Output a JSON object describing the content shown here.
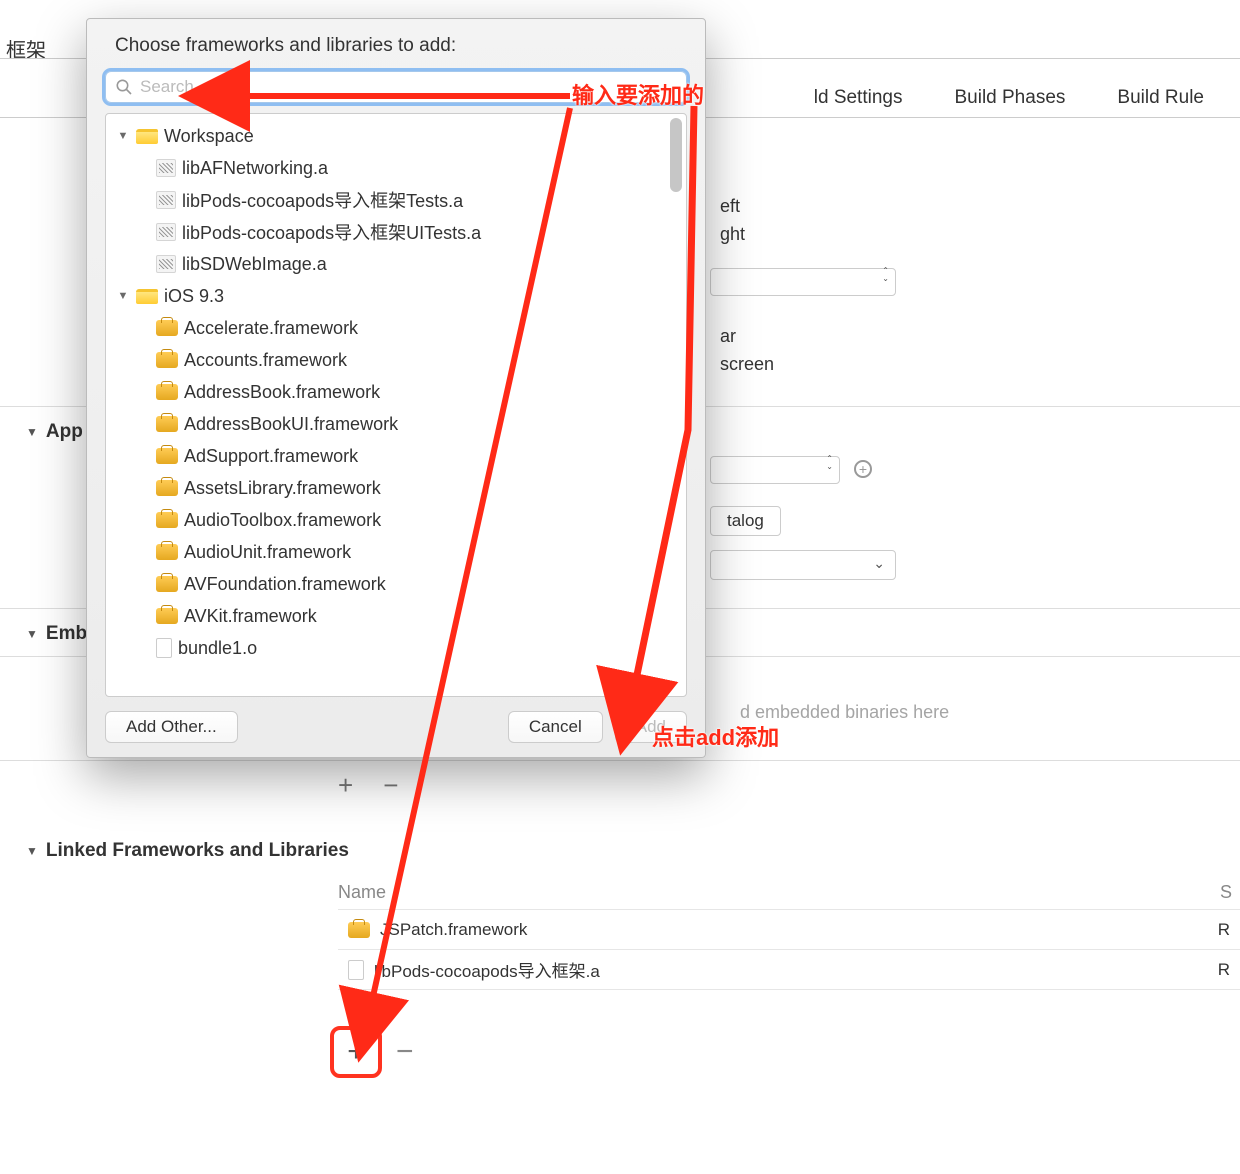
{
  "top_partial": "框架",
  "tabs": {
    "settings": "ld Settings",
    "phases": "Build Phases",
    "rules": "Build Rule"
  },
  "bg": {
    "eft": "eft",
    "ght": "ght",
    "ar": "ar",
    "screen": "screen",
    "talog": "talog",
    "embed_placeholder": "d embedded binaries here"
  },
  "sections": {
    "app": "App I",
    "embed": "Embe",
    "linked": "Linked Frameworks and Libraries"
  },
  "linked": {
    "name_hdr": "Name",
    "status_hdr": "S",
    "rows": [
      {
        "label": "JSPatch.framework",
        "status": "R",
        "icon": "toolbox"
      },
      {
        "label": "libPods-cocoapods导入框架.a",
        "status": "R",
        "icon": "file"
      }
    ]
  },
  "dialog": {
    "title": "Choose frameworks and libraries to add:",
    "search_placeholder": "Search",
    "groups": [
      {
        "label": "Workspace",
        "children": [
          {
            "label": "libAFNetworking.a",
            "icon": "lib"
          },
          {
            "label": "libPods-cocoapods导入框架Tests.a",
            "icon": "lib"
          },
          {
            "label": "libPods-cocoapods导入框架UITests.a",
            "icon": "lib"
          },
          {
            "label": "libSDWebImage.a",
            "icon": "lib"
          }
        ]
      },
      {
        "label": "iOS 9.3",
        "children": [
          {
            "label": "Accelerate.framework",
            "icon": "toolbox"
          },
          {
            "label": "Accounts.framework",
            "icon": "toolbox"
          },
          {
            "label": "AddressBook.framework",
            "icon": "toolbox"
          },
          {
            "label": "AddressBookUI.framework",
            "icon": "toolbox"
          },
          {
            "label": "AdSupport.framework",
            "icon": "toolbox"
          },
          {
            "label": "AssetsLibrary.framework",
            "icon": "toolbox"
          },
          {
            "label": "AudioToolbox.framework",
            "icon": "toolbox"
          },
          {
            "label": "AudioUnit.framework",
            "icon": "toolbox"
          },
          {
            "label": "AVFoundation.framework",
            "icon": "toolbox"
          },
          {
            "label": "AVKit.framework",
            "icon": "toolbox"
          },
          {
            "label": "bundle1.o",
            "icon": "file"
          }
        ]
      }
    ],
    "buttons": {
      "other": "Add Other...",
      "cancel": "Cancel",
      "add": "Add"
    }
  },
  "annotations": {
    "input_hint": "输入要添加的",
    "add_hint": "点击add添加"
  }
}
